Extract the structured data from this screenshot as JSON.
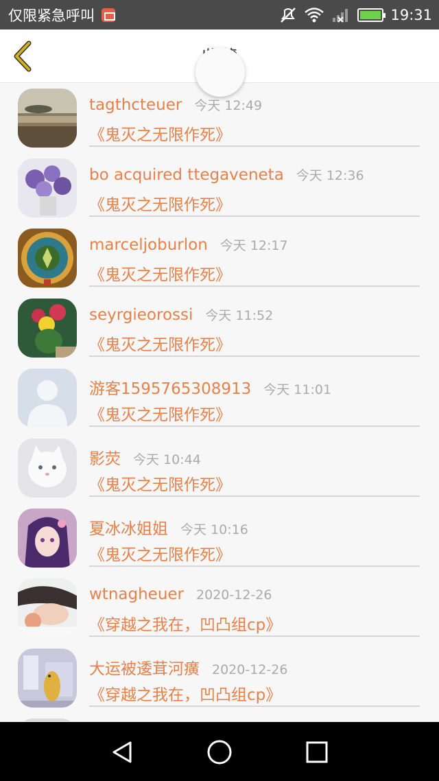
{
  "status_bar": {
    "carrier": "仅限紧急呼叫",
    "time": "19:31",
    "icons": [
      "notification-icon",
      "mute-icon",
      "wifi-icon",
      "no-signal-icon",
      "battery-icon"
    ]
  },
  "header": {
    "title": "收藏",
    "back_icon": "chevron-left-icon"
  },
  "colors": {
    "accent": "#e8804a",
    "time_text": "#aaaaaa",
    "back_arrow": "#d4b11a"
  },
  "items": [
    {
      "name": "tagthcteuer",
      "time": "今天 12:49",
      "book": "《鬼灭之无限作死》",
      "avatar": "avatar-seascape"
    },
    {
      "name": "bo acquired ttegaveneta",
      "time": "今天 12:36",
      "book": "《鬼灭之无限作死》",
      "avatar": "avatar-lavender-flowers"
    },
    {
      "name": "marceljoburlon",
      "time": "今天 12:17",
      "book": "《鬼灭之无限作死》",
      "avatar": "avatar-ornament"
    },
    {
      "name": "seyrgieorossi",
      "time": "今天 11:52",
      "book": "《鬼灭之无限作死》",
      "avatar": "avatar-cactus"
    },
    {
      "name": "游客1595765308913",
      "time": "今天 11:01",
      "book": "《鬼灭之无限作死》",
      "avatar": "avatar-default-person"
    },
    {
      "name": "影荧",
      "time": "今天 10:44",
      "book": "《鬼灭之无限作死》",
      "avatar": "avatar-white-cat"
    },
    {
      "name": "夏冰冰姐姐",
      "time": "今天 10:16",
      "book": "《鬼灭之无限作死》",
      "avatar": "avatar-anime-girl"
    },
    {
      "name": "wtnagheuer",
      "time": "2020-12-26",
      "book": "《穿越之我在，凹凸组cp》",
      "avatar": "avatar-sleeping-girl"
    },
    {
      "name": "大运被逶茸河癀",
      "time": "2020-12-26",
      "book": "《穿越之我在，凹凸组cp》",
      "avatar": "avatar-cartoon-animal"
    }
  ],
  "nav_bar": {
    "buttons": [
      "back-triangle-icon",
      "home-circle-icon",
      "recents-square-icon"
    ]
  }
}
